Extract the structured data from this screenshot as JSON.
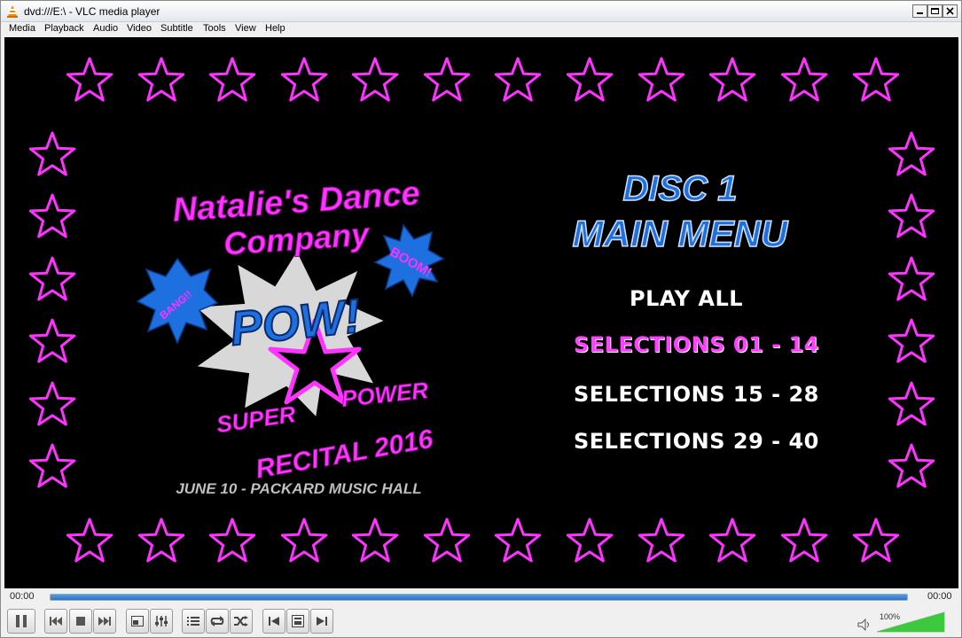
{
  "window": {
    "title": "dvd:///E:\\ - VLC media player"
  },
  "menu": {
    "items": [
      "Media",
      "Playback",
      "Audio",
      "Video",
      "Subtitle",
      "Tools",
      "View",
      "Help"
    ]
  },
  "dvd_menu": {
    "logo": {
      "line1": "Natalie's Dance",
      "line2": "Company",
      "burst_main": "POW!",
      "burst_left": "BANG!!",
      "burst_right": "BOOM!",
      "super": "SUPER",
      "power": "POWER",
      "recital": "RECITAL 2016"
    },
    "date_venue": "JUNE 10 - PACKARD MUSIC HALL",
    "disc_title": "DISC 1",
    "menu_title": "MAIN MENU",
    "options": [
      {
        "label": "PLAY ALL",
        "selected": false
      },
      {
        "label": "SELECTIONS 01 - 14",
        "selected": true
      },
      {
        "label": "SELECTIONS 15 - 28",
        "selected": false
      },
      {
        "label": "SELECTIONS 29 - 40",
        "selected": false
      }
    ]
  },
  "playback": {
    "elapsed": "00:00",
    "total": "00:00",
    "progress": 1.0
  },
  "volume": {
    "percent_label": "100%",
    "level": 1.0
  },
  "colors": {
    "star": "#ff33ff",
    "magenta_text": "#ff33ff",
    "blue_text": "#1e6fe0",
    "seek_fill": "#2f7fd6",
    "volume_fill": "#3cc93c"
  }
}
